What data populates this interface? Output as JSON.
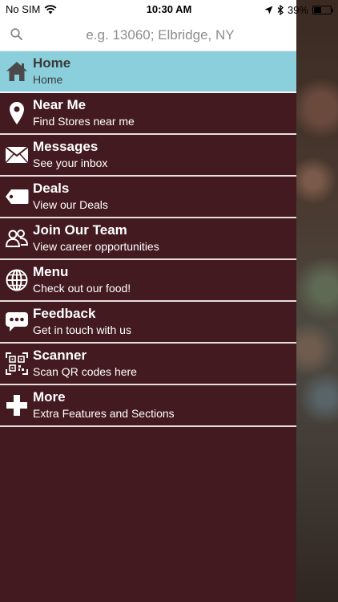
{
  "status_bar": {
    "carrier": "No SIM",
    "time": "10:30 AM",
    "battery": "39%",
    "battery_level": 0.39
  },
  "search": {
    "placeholder": "e.g. 13060; Elbridge, NY",
    "value": ""
  },
  "menu": {
    "items": [
      {
        "title": "Home",
        "subtitle": "Home",
        "icon": "home-icon",
        "active": true
      },
      {
        "title": "Near Me",
        "subtitle": "Find Stores near me",
        "icon": "map-pin-icon"
      },
      {
        "title": "Messages",
        "subtitle": "See your inbox",
        "icon": "envelope-icon"
      },
      {
        "title": "Deals",
        "subtitle": "View our Deals",
        "icon": "tag-icon"
      },
      {
        "title": "Join Our Team",
        "subtitle": "View career opportunities",
        "icon": "people-icon"
      },
      {
        "title": "Menu",
        "subtitle": "Check out our food!",
        "icon": "globe-icon"
      },
      {
        "title": "Feedback",
        "subtitle": "Get in touch with us",
        "icon": "chat-bubble-icon"
      },
      {
        "title": "Scanner",
        "subtitle": "Scan QR codes here",
        "icon": "qr-code-icon"
      },
      {
        "title": "More",
        "subtitle": "Extra Features and Sections",
        "icon": "plus-icon"
      }
    ]
  },
  "colors": {
    "drawer_bg": "#431a20",
    "active_bg": "#8ccfdc",
    "divider": "#e8dedf"
  }
}
